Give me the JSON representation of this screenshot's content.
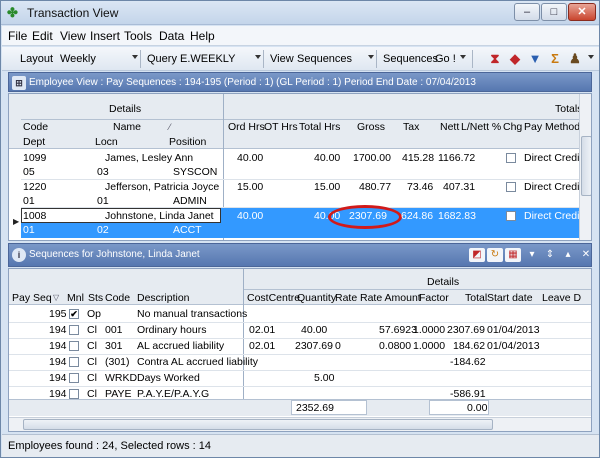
{
  "window": {
    "title": "Transaction View",
    "controls": {
      "minimize": "–",
      "maximize": "□",
      "close": "✕"
    }
  },
  "menu": [
    "File",
    "Edit",
    "View",
    "Insert",
    "Tools",
    "Data",
    "Help"
  ],
  "toolbar": {
    "layout_label": "Layout",
    "layout_value": "Weekly",
    "query_label": "Query",
    "query_value": "E.WEEKLY",
    "view_label": "View",
    "view_value": "Sequences",
    "sequences_label": "Sequences",
    "go_label": "Go !",
    "icons": [
      "hourglass-icon",
      "diamond-icon",
      "filter-icon",
      "sum-icon",
      "people-icon"
    ]
  },
  "employee_panel": {
    "header": "Employee View : Pay Sequences : 194-195 (Period : 1) (GL Period : 1) Period End Date : 07/04/2013",
    "group_details": "Details",
    "group_totals": "Totals",
    "columns_row1": [
      "Code",
      "Name",
      "Ord Hrs",
      "OT Hrs",
      "Total Hrs",
      "Gross",
      "Tax",
      "Nett",
      "L/Nett %",
      "Chg",
      "Pay Method"
    ],
    "columns_row2": [
      "Dept",
      "Locn",
      "Position"
    ],
    "rows": [
      {
        "code": "1099",
        "name": "James, Lesley Ann",
        "dept": "05",
        "locn": "03",
        "position": "SYSCON",
        "ord": "40.00",
        "ot": "",
        "total": "40.00",
        "gross": "1700.00",
        "tax": "415.28",
        "nett": "1166.72",
        "lnett": "",
        "paymethod": "Direct Credit"
      },
      {
        "code": "1220",
        "name": "Jefferson, Patricia Joyce",
        "dept": "01",
        "locn": "01",
        "position": "ADMIN",
        "ord": "15.00",
        "ot": "",
        "total": "15.00",
        "gross": "480.77",
        "tax": "73.46",
        "nett": "407.31",
        "lnett": "",
        "paymethod": "Direct Credit"
      },
      {
        "code": "1008",
        "name": "Johnstone, Linda Janet",
        "dept": "01",
        "locn": "02",
        "position": "ACCT",
        "ord": "40.00",
        "ot": "",
        "total": "40.00",
        "gross": "2307.69",
        "tax": "624.86",
        "nett": "1682.83",
        "lnett": "",
        "paymethod": "Direct Credit"
      }
    ]
  },
  "sequence_panel": {
    "header": "Sequences for Johnstone, Linda Janet",
    "group_details": "Details",
    "columns": [
      "Pay Seq",
      "Mnl",
      "Sts",
      "Code",
      "Description",
      "CostCentre",
      "Quantity",
      "Rate",
      "Rate Amount",
      "Factor",
      "Total",
      "Start date",
      "Leave D"
    ],
    "rows": [
      {
        "payseq": "195",
        "mnl": true,
        "sts": "Op",
        "code": "",
        "desc": "No manual transactions",
        "cc": "",
        "qty": "",
        "rate": "",
        "rateamt": "",
        "factor": "",
        "total": "",
        "start": ""
      },
      {
        "payseq": "194",
        "mnl": false,
        "sts": "Cl",
        "code": "001",
        "desc": "Ordinary hours",
        "cc": "02.01",
        "qty": "40.00",
        "rate": "",
        "rateamt": "57.6923",
        "factor": "1.0000",
        "total": "2307.69",
        "start": "01/04/2013"
      },
      {
        "payseq": "194",
        "mnl": false,
        "sts": "Cl",
        "code": "301",
        "desc": "AL accrued liability",
        "cc": "02.01",
        "qty": "2307.69",
        "rate": "0",
        "rateamt": "0.0800",
        "factor": "1.0000",
        "total": "184.62",
        "start": "01/04/2013"
      },
      {
        "payseq": "194",
        "mnl": false,
        "sts": "Cl",
        "code": "(301)",
        "desc": "Contra AL accrued liability",
        "cc": "",
        "qty": "",
        "rate": "",
        "rateamt": "",
        "factor": "",
        "total": "-184.62",
        "start": ""
      },
      {
        "payseq": "194",
        "mnl": false,
        "sts": "Cl",
        "code": "WRKD",
        "desc": "Days Worked",
        "cc": "",
        "qty": "5.00",
        "rate": "",
        "rateamt": "",
        "factor": "",
        "total": "",
        "start": ""
      },
      {
        "payseq": "194",
        "mnl": false,
        "sts": "Cl",
        "code": "PAYE",
        "desc": "P.A.Y.E/P.A.Y.G",
        "cc": "",
        "qty": "",
        "rate": "",
        "rateamt": "",
        "factor": "",
        "total": "-586.91",
        "start": ""
      }
    ],
    "footer_quantity": "2352.69",
    "footer_total": "0.00"
  },
  "status": {
    "text": "Employees found : 24, Selected rows : 14"
  },
  "colors": {
    "selection": "#3399ff",
    "panel_header": "#5677b0",
    "highlight_ring": "#d11a1a"
  }
}
